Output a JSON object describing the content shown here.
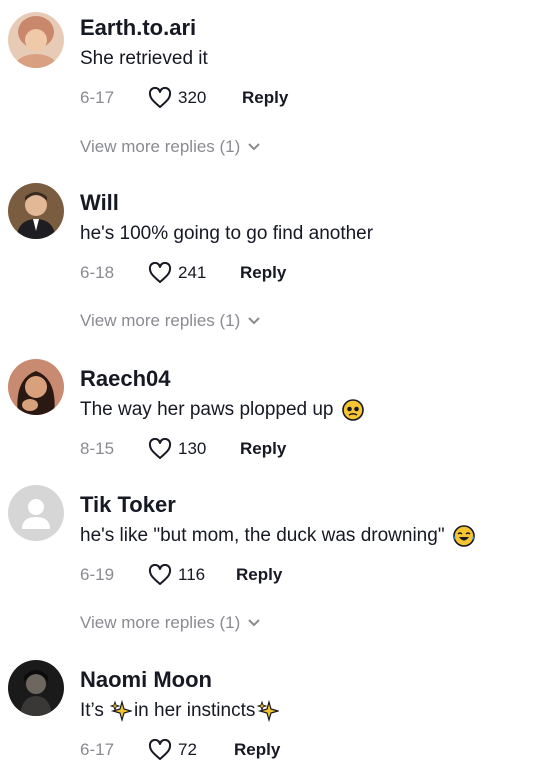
{
  "comments": [
    {
      "username": "Earth.to.ari",
      "text": "She retrieved it",
      "date": "6-17",
      "likes": "320",
      "reply_label": "Reply",
      "view_more": "View more replies (1)",
      "avatar": "woman-smiling-avatar",
      "avatar_color": "#c9876c"
    },
    {
      "username": "Will",
      "text": "he's 100% going to go find another",
      "date": "6-18",
      "likes": "241",
      "reply_label": "Reply",
      "view_more": "View more replies (1)",
      "avatar": "man-in-suit-avatar",
      "avatar_color": "#3a3330"
    },
    {
      "username": "Raech04",
      "text": "The way her paws plopped up",
      "date": "8-15",
      "likes": "130",
      "reply_label": "Reply",
      "emoji": "pleading-face-emoji",
      "avatar": "woman-dark-hair-avatar",
      "avatar_color": "#4a2a20"
    },
    {
      "username": "Tik Toker",
      "text": "he's like \"but mom, the duck was drowning\"",
      "date": "6-19",
      "likes": "116",
      "reply_label": "Reply",
      "view_more": "View more replies (1)",
      "emoji": "tears-of-joy-emoji",
      "avatar": "default-user-avatar",
      "avatar_color": "#d6d6d6"
    },
    {
      "username": "Naomi Moon",
      "text_part1": "It’s",
      "text_part2": "in her instincts",
      "date": "6-17",
      "likes": "72",
      "reply_label": "Reply",
      "emoji": "sparkles-emoji",
      "avatar": "dark-photo-avatar",
      "avatar_color": "#2a2a2a"
    }
  ],
  "colors": {
    "text": "#161823",
    "muted": "#8a8b91",
    "sparkle": "#f4c430",
    "emoji_face": "#f7c531"
  }
}
